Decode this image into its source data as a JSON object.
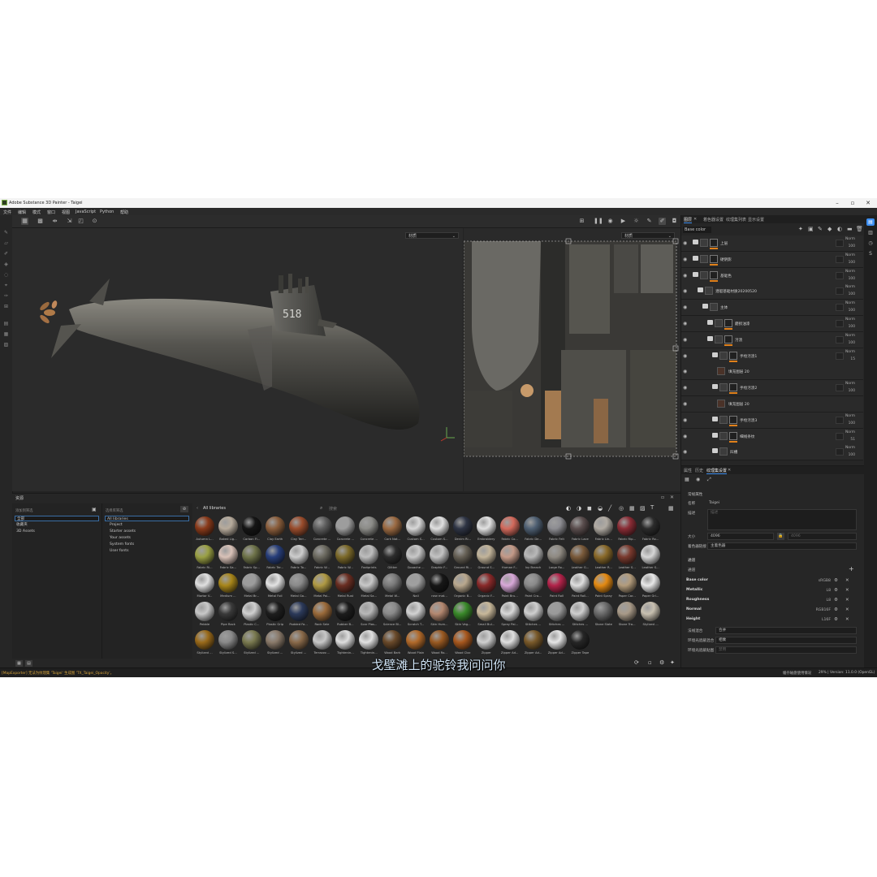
{
  "window": {
    "title": "Adobe Substance 3D Painter - Taigei"
  },
  "menu": [
    "文件",
    "编辑",
    "模式",
    "窗口",
    "视图",
    "JavaScript",
    "Python",
    "帮助"
  ],
  "viewport": {
    "left_mode": "材质",
    "right_mode": "材质",
    "hull_number": "518"
  },
  "layers_panel": {
    "tabs": [
      "图层",
      "着色器设置",
      "纹理集列表",
      "显示设置"
    ],
    "channel": "Base color",
    "layers": [
      {
        "name": "上层",
        "blend": "Norm",
        "opacity": "100",
        "indent": 0,
        "kind": "folder-mask"
      },
      {
        "name": "硬阴影",
        "blend": "Norm",
        "opacity": "100",
        "indent": 0,
        "kind": "folder-mask"
      },
      {
        "name": "基础色",
        "blend": "Norm",
        "opacity": "100",
        "indent": 0,
        "kind": "folder-mask"
      },
      {
        "name": "潜艇基础材质20200520",
        "blend": "Norm",
        "opacity": "100",
        "indent": 1,
        "kind": "folder"
      },
      {
        "name": "主体",
        "blend": "Norm",
        "opacity": "100",
        "indent": 2,
        "kind": "folder"
      },
      {
        "name": "磨损油漆",
        "blend": "Norm",
        "opacity": "100",
        "indent": 3,
        "kind": "folder-mask"
      },
      {
        "name": "污渍",
        "blend": "Norm",
        "opacity": "100",
        "indent": 3,
        "kind": "folder-mask"
      },
      {
        "name": "手绘污渍1",
        "blend": "Norm",
        "opacity": "15",
        "indent": 4,
        "kind": "folder-mask"
      },
      {
        "name": "填充图层 20",
        "blend": "",
        "opacity": "",
        "indent": 5,
        "kind": "fill"
      },
      {
        "name": "手绘污渍2",
        "blend": "Norm",
        "opacity": "100",
        "indent": 4,
        "kind": "folder-mask"
      },
      {
        "name": "填充图层 20",
        "blend": "",
        "opacity": "",
        "indent": 5,
        "kind": "fill"
      },
      {
        "name": "手绘污渍3",
        "blend": "Norm",
        "opacity": "100",
        "indent": 4,
        "kind": "folder-mask"
      },
      {
        "name": "细线条纹",
        "blend": "Norm",
        "opacity": "51",
        "indent": 4,
        "kind": "folder-mask"
      },
      {
        "name": "凹槽",
        "blend": "Norm",
        "opacity": "100",
        "indent": 4,
        "kind": "folder"
      }
    ]
  },
  "properties": {
    "tabs": [
      "属性",
      "历史",
      "纹理集设置"
    ],
    "section_general": "常规属性",
    "name_label": "名称",
    "name_value": "Taigei",
    "desc_label": "描述",
    "desc_placeholder": "描述",
    "size_label": "大小",
    "size_value": "4096",
    "size_value2": "4096",
    "uv_label": "着色器链接",
    "uv_value": "主着色器",
    "channels_title": "通道",
    "channels_add": "通道",
    "channels": [
      {
        "name": "Base color",
        "format": "sRGB8"
      },
      {
        "name": "Metallic",
        "format": "L8"
      },
      {
        "name": "Roughness",
        "format": "L8"
      },
      {
        "name": "Normal",
        "format": "RGB16F"
      },
      {
        "name": "Height",
        "format": "L16F"
      }
    ],
    "mesh_maps_label": "法线混合",
    "mesh_maps_value": "合并",
    "ao_label": "环境光遮蔽混合",
    "ao_value": "相乘",
    "id_label": "环境光遮蔽贴图",
    "id_value": "禁用"
  },
  "assets": {
    "title": "资源",
    "col1_header": "添加到筛选",
    "col1_items": [
      "全部",
      "收藏夹",
      "3D Assets"
    ],
    "col2_header": "选择库筛选",
    "col2_items": [
      "All libraries",
      "Project",
      "Starter assets",
      "Your assets",
      "System fonts",
      "User fonts"
    ],
    "breadcrumb": "All libraries",
    "search_placeholder": "搜索",
    "materials": [
      {
        "label": "Autumn L...",
        "color": "#8a3a1a"
      },
      {
        "label": "Baked Lig...",
        "color": "#b7ab9c"
      },
      {
        "label": "Carbon Fi...",
        "color": "#151515"
      },
      {
        "label": "Clay Earth",
        "color": "#8b5e3c"
      },
      {
        "label": "Clay Terr...",
        "color": "#9a4c2c"
      },
      {
        "label": "Concrete ...",
        "color": "#5e5e5e"
      },
      {
        "label": "Concrete ...",
        "color": "#9d9d9d"
      },
      {
        "label": "Concrete ...",
        "color": "#8c8c88"
      },
      {
        "label": "Cork Nat...",
        "color": "#9b6a42"
      },
      {
        "label": "Custom S...",
        "color": "#d8d8d8"
      },
      {
        "label": "Custom S...",
        "color": "#e0e0e0"
      },
      {
        "label": "Denim Ri...",
        "color": "#2e3444"
      },
      {
        "label": "Embroidery",
        "color": "#e2e2e2"
      },
      {
        "label": "Fabric Co...",
        "color": "#d36a5c"
      },
      {
        "label": "Fabric De...",
        "color": "#4e5f72"
      },
      {
        "label": "Fabric Felt",
        "color": "#8d8d92"
      },
      {
        "label": "Fabric Lace",
        "color": "#5a4d4d"
      },
      {
        "label": "Fabric Lin...",
        "color": "#b0aaa2"
      },
      {
        "label": "Fabric Rip...",
        "color": "#8a2c35"
      },
      {
        "label": "Fabric Ro...",
        "color": "#2b2b2b"
      },
      {
        "label": "Fabric Ri...",
        "color": "#9aa044"
      },
      {
        "label": "Fabric Sa...",
        "color": "#d9c2b8"
      },
      {
        "label": "Fabric Sp...",
        "color": "#6e7349"
      },
      {
        "label": "Fabric Ter...",
        "color": "#273e7a"
      },
      {
        "label": "Fabric To...",
        "color": "#cdcdcd"
      },
      {
        "label": "Fabric W...",
        "color": "#6c6a60"
      },
      {
        "label": "Fabric W...",
        "color": "#7c6a2a"
      },
      {
        "label": "Footprints",
        "color": "#bdbdbd"
      },
      {
        "label": "Glitter",
        "color": "#2c2c2c"
      },
      {
        "label": "Gouache ...",
        "color": "#c8c8c8"
      },
      {
        "label": "Graphic F...",
        "color": "#c3c3c3"
      },
      {
        "label": "Ground Ri...",
        "color": "#666055"
      },
      {
        "label": "Ground S...",
        "color": "#c2b49a"
      },
      {
        "label": "Human F...",
        "color": "#c49a88"
      },
      {
        "label": "Ivy Branch",
        "color": "#b8b8b8"
      },
      {
        "label": "Large Ro...",
        "color": "#8f8a82"
      },
      {
        "label": "Leather G...",
        "color": "#7a5a3a"
      },
      {
        "label": "Leather R...",
        "color": "#8a6a2a"
      },
      {
        "label": "Leather S...",
        "color": "#7a3a2e"
      },
      {
        "label": "Leather S...",
        "color": "#d6d6d6"
      },
      {
        "label": "Mortar V...",
        "color": "#e0e0e0"
      },
      {
        "label": "Medium ...",
        "color": "#a8861a"
      },
      {
        "label": "Metal Br...",
        "color": "#9c9c9c"
      },
      {
        "label": "Metal Foil",
        "color": "#e3e3e3"
      },
      {
        "label": "Metal Ga...",
        "color": "#8a8a8a"
      },
      {
        "label": "Metal Pai...",
        "color": "#b09a44"
      },
      {
        "label": "Metal Rust",
        "color": "#6a2e22"
      },
      {
        "label": "Metal Sa...",
        "color": "#c8c8c8"
      },
      {
        "label": "Metal W...",
        "color": "#7a7a7a"
      },
      {
        "label": "Nail",
        "color": "#a0a0a0"
      },
      {
        "label": "new mat...",
        "color": "#171717"
      },
      {
        "label": "Organic B...",
        "color": "#b9a88e"
      },
      {
        "label": "Organic F...",
        "color": "#8a2a2a"
      },
      {
        "label": "Paint Bru...",
        "color": "#d8a8d8"
      },
      {
        "label": "Paint Cra...",
        "color": "#8a8a8a"
      },
      {
        "label": "Paint Roll",
        "color": "#b3234a"
      },
      {
        "label": "Paint Roll...",
        "color": "#dedede"
      },
      {
        "label": "Paint Spray",
        "color": "#e48a12"
      },
      {
        "label": "Paper Car...",
        "color": "#b39c7c"
      },
      {
        "label": "Paper Gri...",
        "color": "#e8e8e8"
      },
      {
        "label": "Pebble",
        "color": "#c8c8c8"
      },
      {
        "label": "Pipe Rack",
        "color": "#3a3a3a"
      },
      {
        "label": "Plastic C...",
        "color": "#d0d0d0"
      },
      {
        "label": "Plastic Grip",
        "color": "#1e1e1e"
      },
      {
        "label": "Podded Fa...",
        "color": "#2c3a5a"
      },
      {
        "label": "Rock Sele",
        "color": "#9a6a3a"
      },
      {
        "label": "Rubber B...",
        "color": "#1c1c1c"
      },
      {
        "label": "Scar Plas...",
        "color": "#b8b8b8"
      },
      {
        "label": "Science Bl...",
        "color": "#8a8a8a"
      },
      {
        "label": "Scratch T...",
        "color": "#d2d2d2"
      },
      {
        "label": "Skin Hum...",
        "color": "#b48870"
      },
      {
        "label": "Skin Veg...",
        "color": "#3a8a2a"
      },
      {
        "label": "Small Bul...",
        "color": "#c8b89a"
      },
      {
        "label": "Spray Pai...",
        "color": "#d8d8d8"
      },
      {
        "label": "Stitches ...",
        "color": "#cfcfcf"
      },
      {
        "label": "Stitches ...",
        "color": "#9a9a9a"
      },
      {
        "label": "Stitches ...",
        "color": "#cfcfcf"
      },
      {
        "label": "Stone Slate",
        "color": "#6a6a6a"
      },
      {
        "label": "Stone Tra...",
        "color": "#a89a88"
      },
      {
        "label": "Stylized ...",
        "color": "#c8c0b0"
      },
      {
        "label": "Stylized ...",
        "color": "#9a6a1a"
      },
      {
        "label": "Stylized S...",
        "color": "#8a8a8a"
      },
      {
        "label": "Stylized ...",
        "color": "#7a7a50"
      },
      {
        "label": "Stylized ...",
        "color": "#8a7a6a"
      },
      {
        "label": "Stylized ...",
        "color": "#8a6a4a"
      },
      {
        "label": "Terrazzo ...",
        "color": "#c8c8c8"
      },
      {
        "label": "Tightenin...",
        "color": "#dedede"
      },
      {
        "label": "Tightenin...",
        "color": "#e2e2e2"
      },
      {
        "label": "Wood Bark",
        "color": "#6a4a2a"
      },
      {
        "label": "Wood Plain",
        "color": "#b26a2a"
      },
      {
        "label": "Wood Ro...",
        "color": "#9a5a22"
      },
      {
        "label": "Wood Cloc",
        "color": "#a8581e"
      },
      {
        "label": "Zipper",
        "color": "#d0d0d0"
      },
      {
        "label": "Zipper Ad...",
        "color": "#e0e0e0"
      },
      {
        "label": "Zipper Ad...",
        "color": "#7a5a2a"
      },
      {
        "label": "Zipper Ad...",
        "color": "#e6e6e6"
      },
      {
        "label": "Zipper Tape",
        "color": "#262626"
      }
    ]
  },
  "status": {
    "message": "[MapExporter] 无法为纹理集 'Taigei' 生成图 'TX_Taigei_Opacity'。",
    "right1": "缓存磁盘使用情况",
    "right2": "29% | Version: 11.0.0 (OpenGL)"
  },
  "subtitle": "戈壁滩上的驼铃我问问你",
  "colors": {
    "accent": "#3d8ef0",
    "orange": "#e0801a",
    "bg": "#232323"
  }
}
